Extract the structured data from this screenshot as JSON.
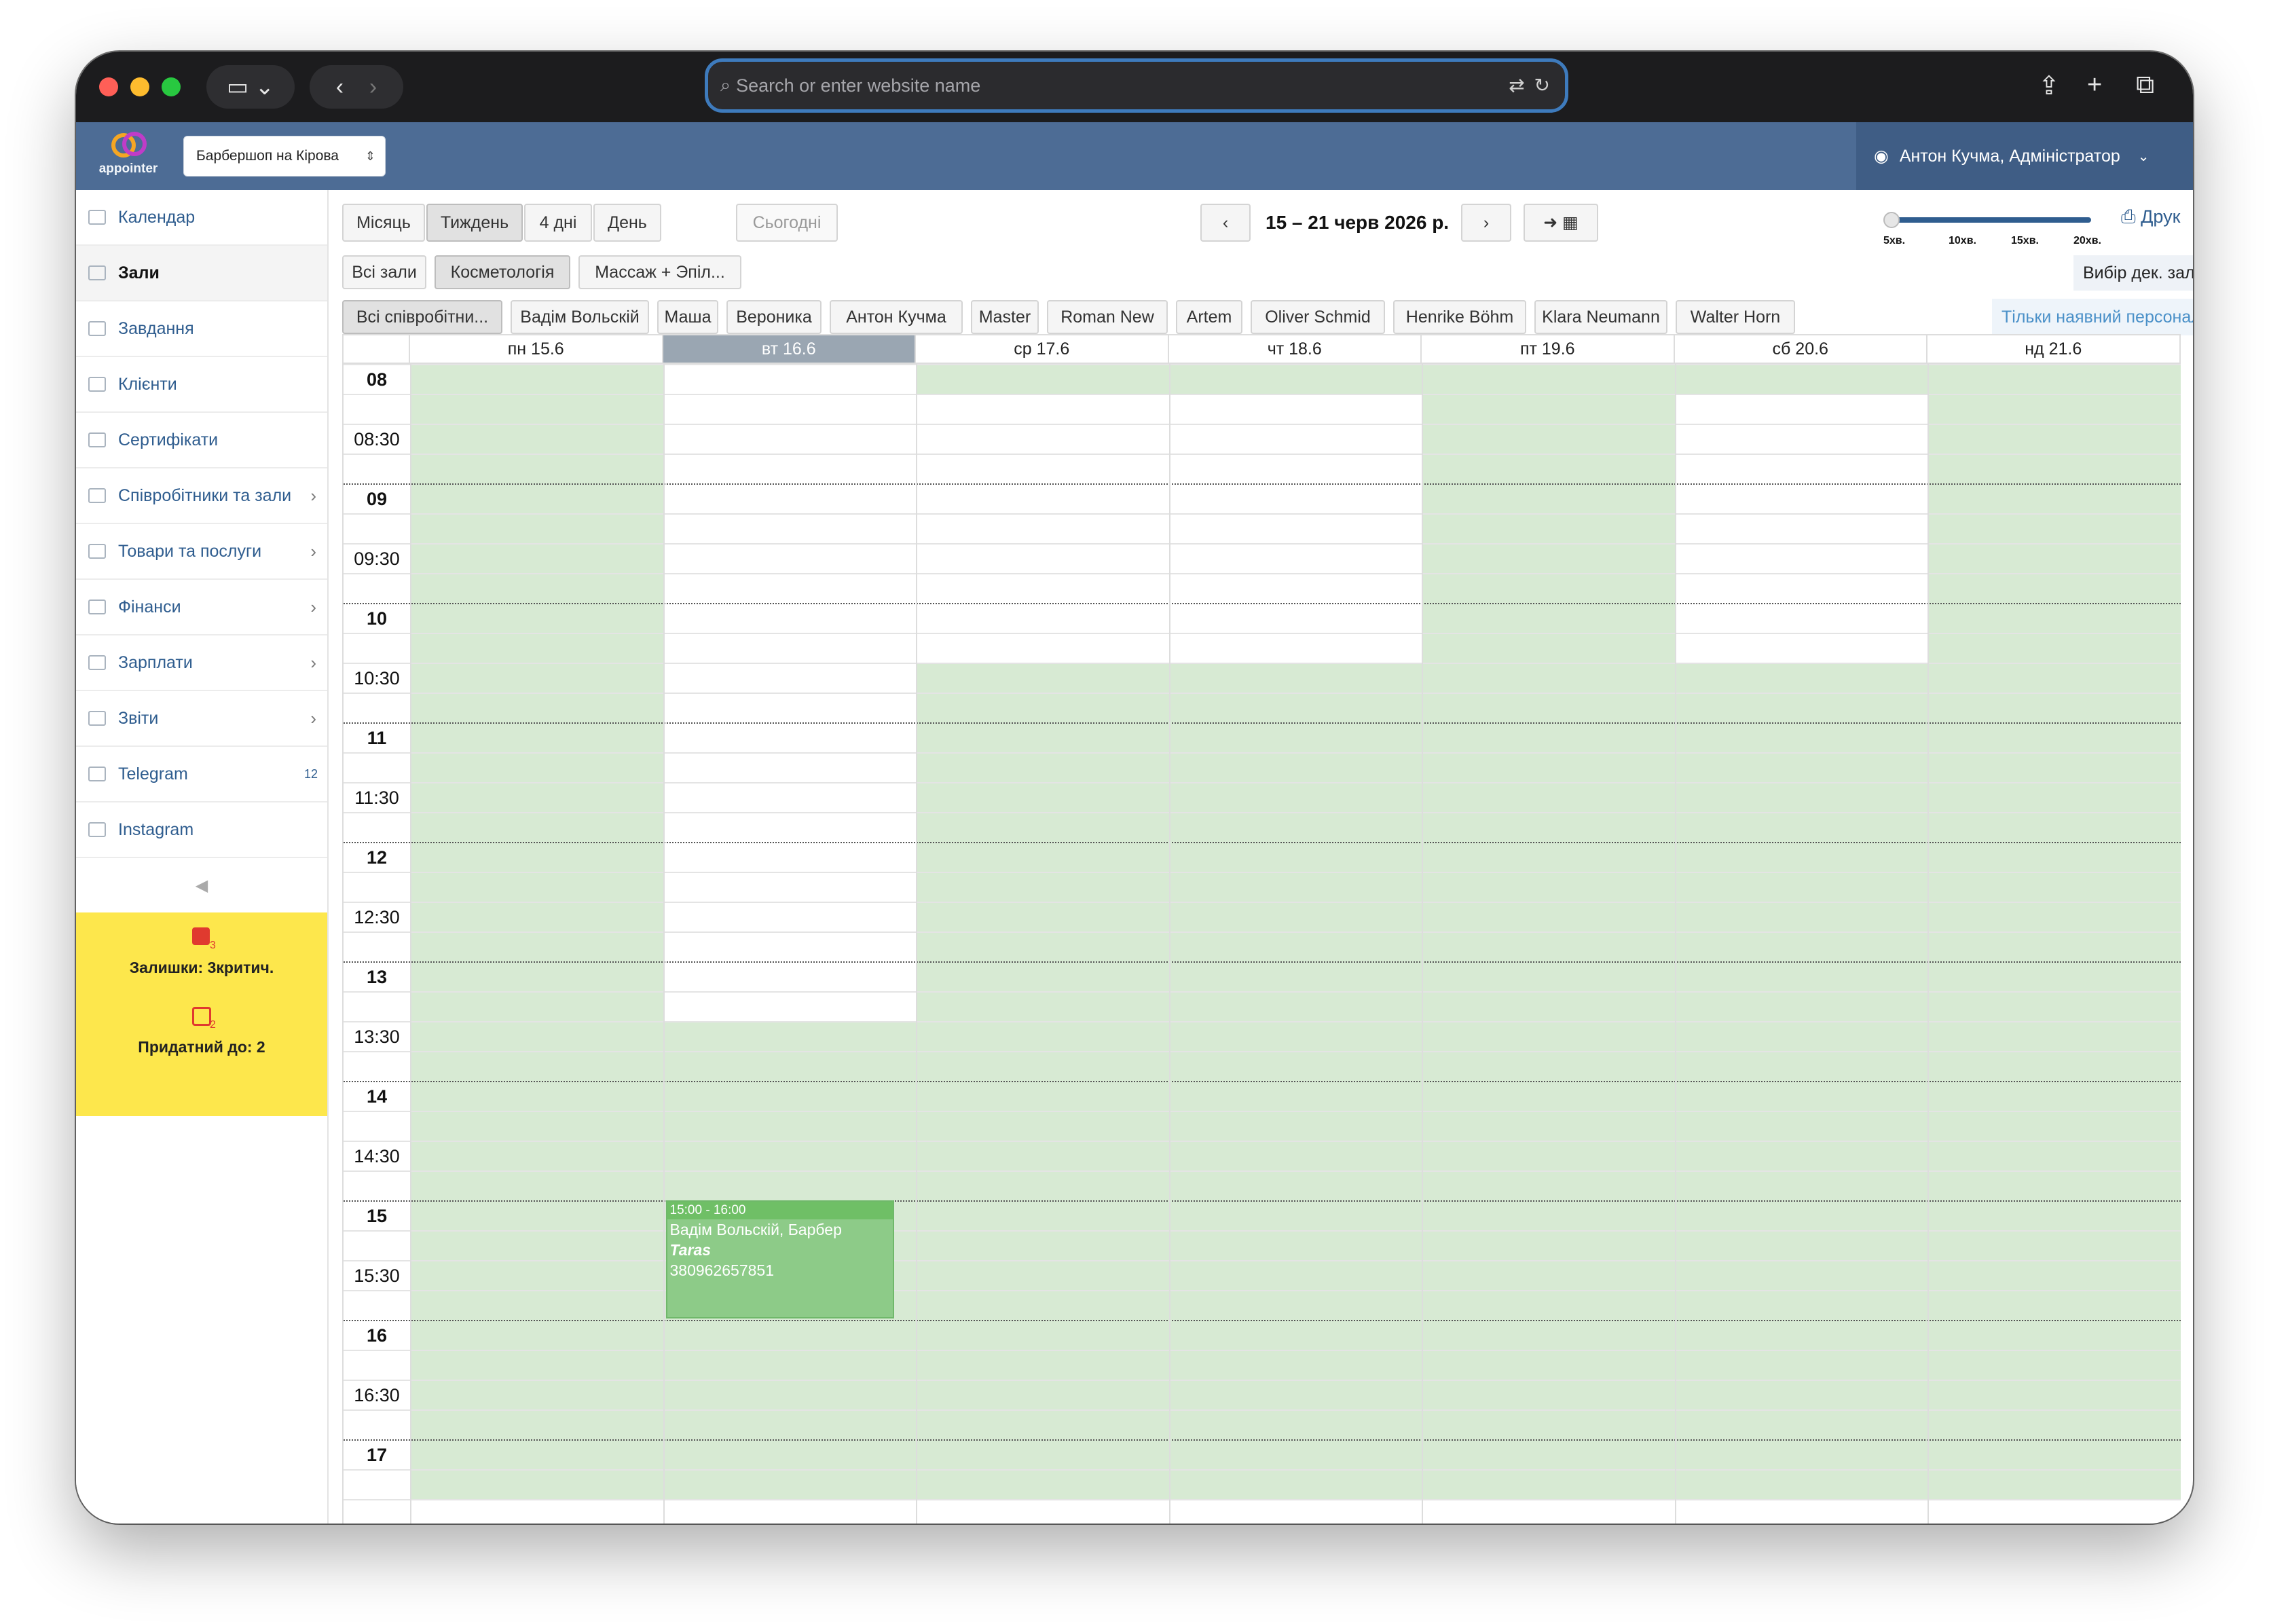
{
  "browser": {
    "url_placeholder": "Search or enter website name"
  },
  "app": {
    "logo_text": "appointer",
    "branch": "Барбершоп на Кірова",
    "user": "Антон Кучма, Адміністратор"
  },
  "sidebar": {
    "items": [
      {
        "label": "Календар",
        "arrow": false,
        "badge": ""
      },
      {
        "label": "Зали",
        "arrow": false,
        "badge": "",
        "active": true
      },
      {
        "label": "Завдання",
        "arrow": false,
        "badge": ""
      },
      {
        "label": "Клієнти",
        "arrow": false,
        "badge": ""
      },
      {
        "label": "Сертифікати",
        "arrow": false,
        "badge": ""
      },
      {
        "label": "Співробітники та зали",
        "arrow": true,
        "badge": ""
      },
      {
        "label": "Товари та послуги",
        "arrow": true,
        "badge": ""
      },
      {
        "label": "Фінанси",
        "arrow": true,
        "badge": ""
      },
      {
        "label": "Зарплати",
        "arrow": true,
        "badge": ""
      },
      {
        "label": "Звіти",
        "arrow": true,
        "badge": ""
      },
      {
        "label": "Telegram",
        "arrow": false,
        "badge": "12"
      },
      {
        "label": "Instagram",
        "arrow": false,
        "badge": ""
      }
    ],
    "alerts": [
      {
        "count": "3",
        "text": "Залишки: 3критич."
      },
      {
        "count": "2",
        "text": "Придатний до: 2"
      }
    ]
  },
  "toolbar": {
    "views": [
      "Місяць",
      "Тиждень",
      "4 дні",
      "День"
    ],
    "active_view": "Тиждень",
    "today": "Сьогодні",
    "range": "15 – 21 черв 2026 р.",
    "print": "Друк",
    "zoom_labels": [
      "5хв.",
      "10хв.",
      "15хв.",
      "20хв."
    ],
    "multi_hall": "Вибір дек. залів",
    "only_available": "Тільки наявний персонал"
  },
  "halls": [
    "Всі зали",
    "Косметологія",
    "Массаж + Эпіл..."
  ],
  "active_hall": "Косметологія",
  "staff": [
    "Всі співробітни...",
    "Вадім Вольскій",
    "Маша",
    "Вероника",
    "Антон Кучма",
    "Master",
    "Roman New",
    "Artem",
    "Oliver Schmid",
    "Henrike Böhm",
    "Klara Neumann",
    "Walter Horn"
  ],
  "calendar": {
    "days": [
      "пн 15.6",
      "вт 16.6",
      "ср 17.6",
      "чт 18.6",
      "пт 19.6",
      "сб 20.6",
      "нд 21.6"
    ],
    "today_index": 1,
    "times": [
      "08",
      "08:30",
      "09",
      "09:30",
      "10",
      "10:30",
      "11",
      "11:30",
      "12",
      "12:30",
      "13",
      "13:30",
      "14",
      "14:30",
      "15",
      "15:30",
      "16",
      "16:30",
      "17"
    ],
    "event": {
      "time": "15:00 - 16:00",
      "staff": "Вадім Вольскій, Барбер",
      "client": "Taras",
      "phone": "380962657851",
      "color": "#8dcb88"
    }
  },
  "colors": {
    "accent": "#4d6c95",
    "link": "#2f5d8f",
    "busy": "#d7ead3",
    "alert_bg": "#fde74c"
  }
}
